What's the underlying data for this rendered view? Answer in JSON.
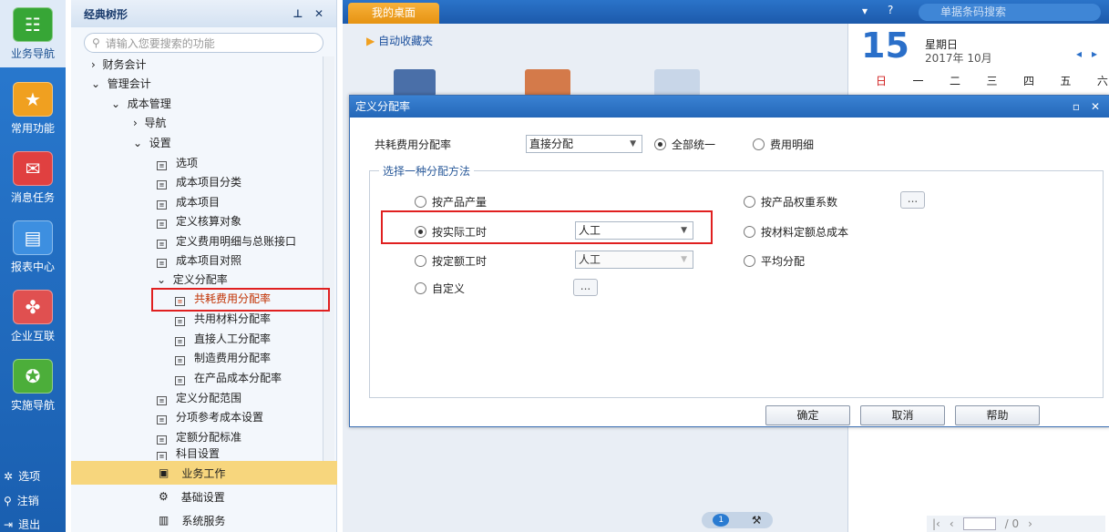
{
  "rail": {
    "items": [
      {
        "label": "业务导航",
        "icon": "business-nav-icon"
      },
      {
        "label": "常用功能",
        "icon": "star-icon"
      },
      {
        "label": "消息任务",
        "icon": "mail-icon"
      },
      {
        "label": "报表中心",
        "icon": "report-icon"
      },
      {
        "label": "企业互联",
        "icon": "link-icon"
      },
      {
        "label": "实施导航",
        "icon": "compass-icon"
      }
    ],
    "bottom": [
      {
        "label": "选项"
      },
      {
        "label": "注销"
      },
      {
        "label": "退出"
      }
    ]
  },
  "tree": {
    "title": "经典树形",
    "search_placeholder": "请输入您要搜索的功能",
    "items": [
      {
        "label": "财务会计",
        "arrow": "›"
      },
      {
        "label": "管理会计",
        "arrow": "⌄"
      },
      {
        "label": "成本管理",
        "arrow": "⌄"
      },
      {
        "label": "导航",
        "arrow": "›"
      },
      {
        "label": "设置",
        "arrow": "⌄"
      },
      {
        "label": "选项"
      },
      {
        "label": "成本项目分类"
      },
      {
        "label": "成本项目"
      },
      {
        "label": "定义核算对象"
      },
      {
        "label": "定义费用明细与总账接口"
      },
      {
        "label": "成本项目对照"
      },
      {
        "label": "定义分配率",
        "arrow": "⌄"
      },
      {
        "label": "共耗费用分配率"
      },
      {
        "label": "共用材料分配率"
      },
      {
        "label": "直接人工分配率"
      },
      {
        "label": "制造费用分配率"
      },
      {
        "label": "在产品成本分配率"
      },
      {
        "label": "定义分配范围"
      },
      {
        "label": "分项参考成本设置"
      },
      {
        "label": "定额分配标准"
      },
      {
        "label": "科目设置"
      }
    ]
  },
  "bottom_menu": [
    {
      "label": "业务工作"
    },
    {
      "label": "基础设置"
    },
    {
      "label": "系统服务"
    }
  ],
  "desktop": {
    "tab": "我的桌面",
    "favorites": "自动收藏夹",
    "search_placeholder": "单据条码搜索"
  },
  "calendar": {
    "day": "15",
    "weekday": "星期日",
    "month": "2017年 10月",
    "week": [
      "日",
      "一",
      "二",
      "三",
      "四",
      "五",
      "六"
    ],
    "pager": "/ 0"
  },
  "pager_page": "1",
  "dialog": {
    "title": "定义分配率",
    "shared_label": "共耗费用分配率",
    "shared_value": "直接分配",
    "opt_all": "全部统一",
    "opt_detail": "费用明细",
    "group": "选择一种分配方法",
    "m1": "按产品产量",
    "m2": "按实际工时",
    "m3": "按定额工时",
    "m4": "自定义",
    "m5": "按产品权重系数",
    "m6": "按材料定额总成本",
    "m7": "平均分配",
    "combo2": "人工",
    "combo3": "人工",
    "ok": "确定",
    "cancel": "取消",
    "help": "帮助"
  }
}
